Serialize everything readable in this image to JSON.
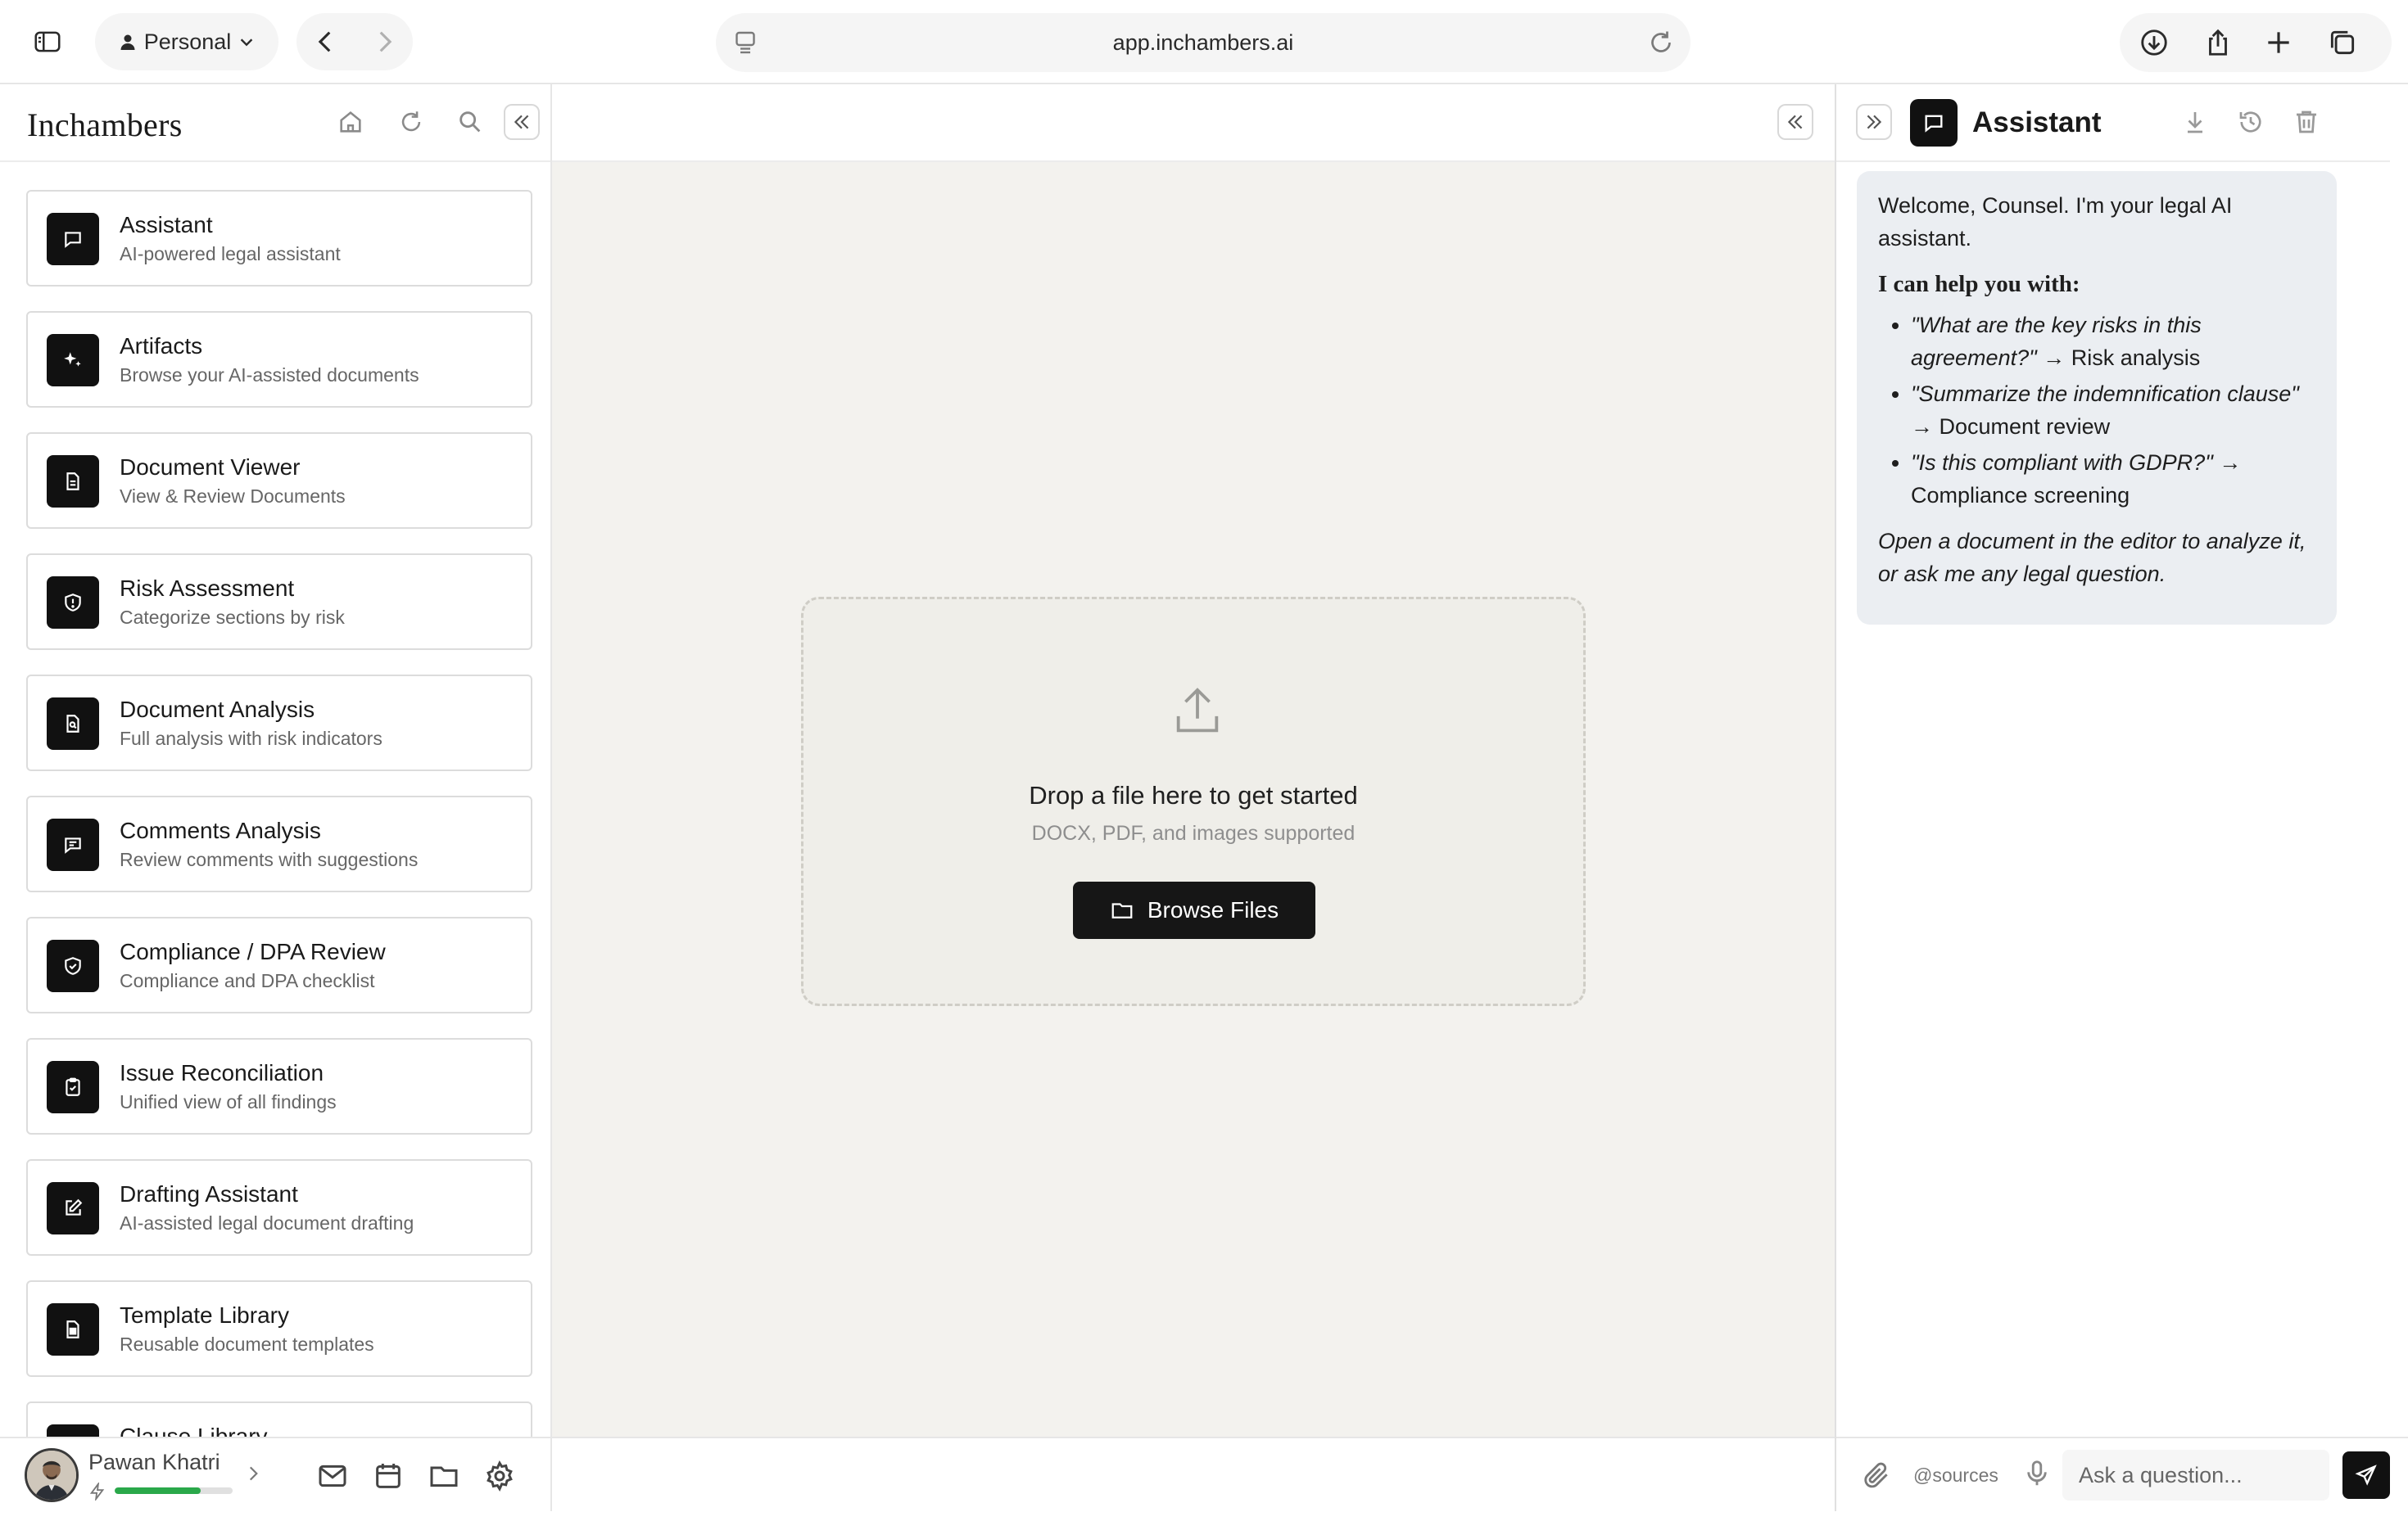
{
  "browser": {
    "profile_label": "Personal",
    "url": "app.inchambers.ai"
  },
  "sidebar": {
    "brand": "Inchambers",
    "cards": [
      {
        "title": "Assistant",
        "subtitle": "AI-powered legal assistant",
        "icon": "chat-icon"
      },
      {
        "title": "Artifacts",
        "subtitle": "Browse your AI-assisted documents",
        "icon": "sparkle-icon"
      },
      {
        "title": "Document Viewer",
        "subtitle": "View & Review Documents",
        "icon": "document-icon"
      },
      {
        "title": "Risk Assessment",
        "subtitle": "Categorize sections by risk",
        "icon": "shield-alert-icon"
      },
      {
        "title": "Document Analysis",
        "subtitle": "Full analysis with risk indicators",
        "icon": "document-search-icon"
      },
      {
        "title": "Comments Analysis",
        "subtitle": "Review comments with suggestions",
        "icon": "comment-icon"
      },
      {
        "title": "Compliance / DPA Review",
        "subtitle": "Compliance and DPA checklist",
        "icon": "shield-check-icon"
      },
      {
        "title": "Issue Reconciliation",
        "subtitle": "Unified view of all findings",
        "icon": "clipboard-check-icon"
      },
      {
        "title": "Drafting Assistant",
        "subtitle": "AI-assisted legal document drafting",
        "icon": "edit-icon"
      },
      {
        "title": "Template Library",
        "subtitle": "Reusable document templates",
        "icon": "template-icon"
      },
      {
        "title": "Clause Library",
        "subtitle": "",
        "icon": "library-icon"
      }
    ],
    "user": {
      "name": "Pawan Khatri",
      "usage_fraction": 0.73
    }
  },
  "main": {
    "dropzone": {
      "title": "Drop a file here to get started",
      "subtitle": "DOCX, PDF, and images supported",
      "browse_label": "Browse Files"
    }
  },
  "assistant": {
    "title": "Assistant",
    "welcome": "Welcome, Counsel. I'm your legal AI assistant.",
    "help_heading": "I can help you with:",
    "examples": [
      {
        "query": "\"What are the key risks in this agreement?\"",
        "result": "Risk analysis"
      },
      {
        "query": "\"Summarize the indemnification clause\"",
        "result": "Document review"
      },
      {
        "query": "\"Is this compliant with GDPR?\"",
        "result": "Compliance screening"
      }
    ],
    "arrow": "→",
    "closing": "Open a document in the editor to analyze it, or ask me any legal question.",
    "sources_label": "@sources",
    "input_placeholder": "Ask a question..."
  },
  "colors": {
    "accent_dark": "#111111",
    "canvas_bg": "#f3f2ee",
    "bubble_bg": "#ebeef2",
    "progress": "#2aa84a"
  }
}
